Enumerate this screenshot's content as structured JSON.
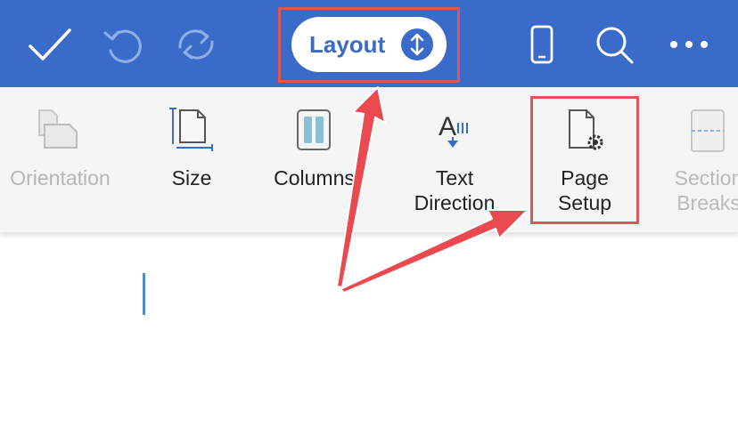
{
  "toolbar": {
    "done_icon": "checkmark-icon",
    "undo_icon": "undo-icon",
    "redo_icon": "redo-icon",
    "tab_switcher_label": "Layout",
    "tab_switcher_icon": "up-down-arrows-icon",
    "view_icon": "phone-view-icon",
    "search_icon": "search-icon",
    "more_icon": "more-icon"
  },
  "ribbon": {
    "items": [
      {
        "label": "Orientation",
        "icon": "orientation-icon"
      },
      {
        "label": "Size",
        "icon": "page-size-icon"
      },
      {
        "label": "Columns",
        "icon": "columns-icon"
      },
      {
        "label": "Text\nDirection",
        "icon": "text-direction-icon"
      },
      {
        "label": "Page\nSetup",
        "icon": "page-setup-icon"
      },
      {
        "label": "Section\nBreaks",
        "icon": "section-breaks-icon"
      }
    ]
  },
  "colors": {
    "accent": "#3a6bc8",
    "highlight": "#e0555b",
    "cursor": "#4a90b8"
  }
}
